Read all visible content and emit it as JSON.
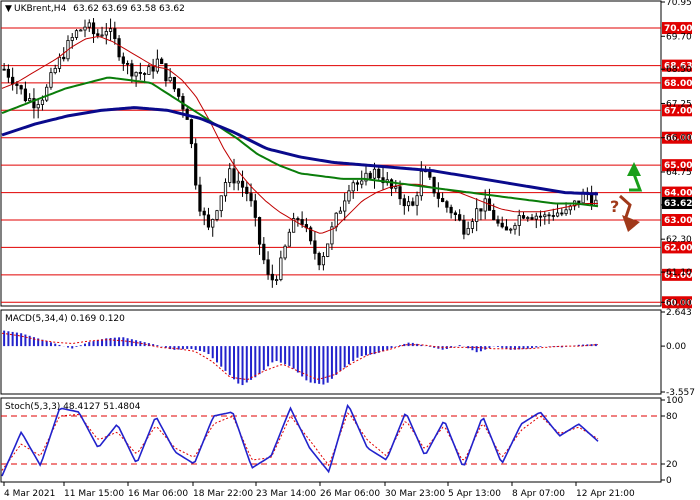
{
  "header": {
    "symbol": "UKBrent,H4",
    "ohlc": "63.62 63.69 63.58 63.62",
    "macd_label": "MACD(5,34,4) 0.169 0.120",
    "stoch_label": "Stoch(5,3,3) 48.4127 51.4804"
  },
  "colors": {
    "candles": "#000000",
    "ma_fast": "#c00000",
    "ma_mid": "#0a7d0a",
    "ma_slow": "#0a0a8c",
    "level_lines": "#e00000",
    "macd_hist": "#2222cc",
    "macd_signal": "#e00000",
    "stoch_main": "#2222cc",
    "stoch_signal": "#e00000",
    "arrow_up": "#1a9e1a",
    "arrow_down": "#a0391a",
    "current_price_box": "#000000"
  },
  "annotations": {
    "question_mark": "?",
    "arrow_up_icon": "arrow-up-icon",
    "arrow_down_icon": "arrow-down-icon"
  },
  "chart_data": [
    {
      "type": "candlestick",
      "title": "UKBrent,H4",
      "price_axis_ticks": [
        "70.95",
        "69.70",
        "68.50",
        "67.25",
        "66.00",
        "64.75",
        "63.55",
        "62.30",
        "61.10",
        "60.00"
      ],
      "ylim": [
        59.9,
        70.95
      ],
      "levels": [
        "70.00",
        "68.63",
        "68.00",
        "67.00",
        "66.00",
        "65.00",
        "64.00",
        "63.00",
        "62.00",
        "61.00",
        "60.00"
      ],
      "current_price": "63.62",
      "x_tick_labels": [
        "4 Mar 2021",
        "11 Mar 15:00",
        "16 Mar 06:00",
        "18 Mar 22:00",
        "23 Mar 14:00",
        "26 Mar 06:00",
        "30 Mar 23:00",
        "5 Apr 13:00",
        "8 Apr 07:00",
        "12 Apr 21:00"
      ],
      "close_path": [
        68.5,
        68.1,
        67.5,
        67.3,
        67.6,
        68.5,
        69.2,
        69.8,
        70.1,
        69.7,
        70.0,
        69.4,
        68.6,
        68.4,
        68.3,
        68.8,
        68.2,
        67.6,
        66.8,
        63.8,
        62.6,
        63.7,
        64.7,
        64.4,
        63.9,
        62.2,
        60.7,
        61.2,
        62.6,
        63.2,
        62.1,
        61.5,
        62.5,
        63.5,
        64.5,
        64.2,
        64.8,
        64.6,
        64.1,
        63.8,
        63.4,
        64.8,
        64.2,
        63.6,
        63.3,
        62.7,
        63.2,
        63.6,
        63.1,
        62.4,
        63.0,
        63.3,
        63.2,
        63.1,
        63.3,
        63.2,
        63.6,
        64.0,
        63.62
      ],
      "ma_fast_path": [
        67.8,
        68.0,
        68.3,
        68.6,
        68.9,
        69.3,
        69.6,
        69.7,
        69.5,
        69.2,
        68.9,
        68.6,
        68.5,
        68.1,
        67.5,
        66.6,
        65.6,
        64.8,
        64.2,
        63.7,
        63.3,
        63.0,
        62.7,
        62.5,
        62.7,
        63.2,
        63.7,
        64.0,
        64.2,
        64.3,
        64.3,
        64.2,
        64.1,
        64.0,
        63.8,
        63.6,
        63.4,
        63.3,
        63.3,
        63.3,
        63.4,
        63.5,
        63.6,
        63.6
      ],
      "ma_mid_path": [
        66.9,
        67.2,
        67.5,
        67.8,
        68.0,
        68.2,
        68.1,
        68.0,
        67.5,
        67.0,
        66.5,
        66.0,
        65.4,
        65.0,
        64.7,
        64.6,
        64.5,
        64.5,
        64.4,
        64.3,
        64.2,
        64.1,
        64.0,
        63.9,
        63.8,
        63.7,
        63.6,
        63.6,
        63.5
      ],
      "ma_slow_path": [
        66.1,
        66.5,
        66.8,
        67.0,
        67.1,
        67.0,
        66.7,
        66.2,
        65.6,
        65.3,
        65.1,
        65.0,
        64.9,
        64.8,
        64.6,
        64.4,
        64.2,
        64.0,
        63.95
      ],
      "macd": {
        "ylim": [
          -3.557,
          2.643
        ],
        "ticks": [
          "2.643",
          "0.00",
          "-3.557"
        ],
        "hist_path": [
          1.2,
          1.0,
          0.6,
          0.2,
          -0.2,
          0.3,
          0.6,
          0.7,
          0.4,
          0.1,
          -0.3,
          -0.2,
          -0.5,
          -1.8,
          -3.1,
          -2.3,
          -1.1,
          -1.6,
          -2.8,
          -3.0,
          -1.8,
          -0.8,
          -0.6,
          -0.1,
          0.3,
          0.0,
          -0.3,
          0.1,
          -0.5,
          0.0,
          -0.3,
          -0.2,
          0.0,
          -0.1,
          0.1,
          0.169
        ],
        "signal_path": [
          1.0,
          0.8,
          0.5,
          0.3,
          0.2,
          0.4,
          0.5,
          0.4,
          0.2,
          -0.1,
          -0.2,
          -0.4,
          -1.2,
          -2.4,
          -2.6,
          -1.9,
          -1.4,
          -2.0,
          -2.6,
          -2.2,
          -1.3,
          -0.6,
          -0.3,
          0.1,
          0.1,
          -0.1,
          -0.1,
          -0.1,
          -0.2,
          -0.2,
          -0.2,
          -0.1,
          0.0,
          0.0,
          0.12
        ]
      },
      "stoch": {
        "ylim": [
          0,
          100
        ],
        "ticks": [
          "100",
          "80",
          "20",
          "0"
        ],
        "levels": [
          80,
          20
        ],
        "main_path": [
          5,
          60,
          18,
          90,
          85,
          40,
          70,
          20,
          80,
          35,
          20,
          80,
          85,
          15,
          30,
          90,
          40,
          10,
          95,
          40,
          25,
          85,
          30,
          75,
          15,
          80,
          20,
          70,
          85,
          55,
          70,
          48.4127
        ],
        "signal_path": [
          12,
          45,
          30,
          80,
          82,
          50,
          60,
          32,
          68,
          40,
          28,
          70,
          80,
          25,
          28,
          80,
          50,
          18,
          85,
          50,
          30,
          75,
          38,
          68,
          22,
          72,
          28,
          62,
          80,
          58,
          66,
          51.4804
        ]
      }
    }
  ]
}
